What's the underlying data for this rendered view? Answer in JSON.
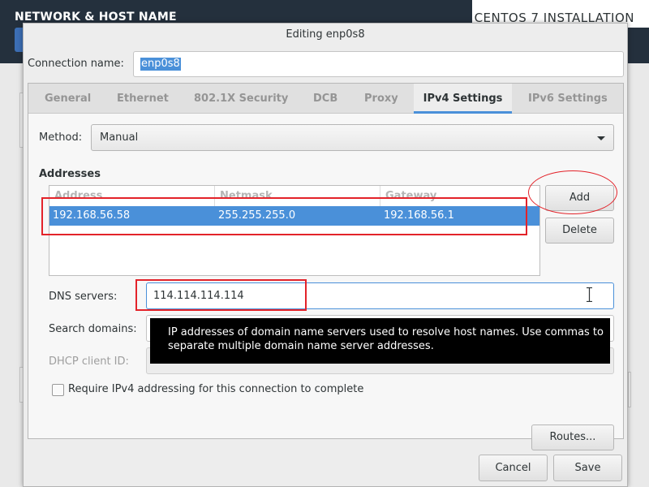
{
  "installer": {
    "title": "NETWORK & HOST NAME",
    "product": "CENTOS 7 INSTALLATION"
  },
  "dialog": {
    "title": "Editing enp0s8",
    "connection_name_label": "Connection name:",
    "connection_name_value": "enp0s8"
  },
  "tabs": [
    {
      "label": "General"
    },
    {
      "label": "Ethernet"
    },
    {
      "label": "802.1X Security"
    },
    {
      "label": "DCB"
    },
    {
      "label": "Proxy"
    },
    {
      "label": "IPv4 Settings",
      "active": true
    },
    {
      "label": "IPv6 Settings"
    }
  ],
  "ipv4": {
    "method_label": "Method:",
    "method_value": "Manual",
    "addresses_heading": "Addresses",
    "columns": [
      "Address",
      "Netmask",
      "Gateway"
    ],
    "rows": [
      {
        "address": "192.168.56.58",
        "netmask": "255.255.255.0",
        "gateway": "192.168.56.1"
      }
    ],
    "add_label": "Add",
    "delete_label": "Delete",
    "dns_label": "DNS servers:",
    "dns_value": "114.114.114.114",
    "search_label": "Search domains:",
    "dhcp_label": "DHCP client ID:",
    "tooltip": "IP addresses of domain name servers used to resolve host names. Use commas to separate multiple domain name server addresses.",
    "require_label": "Require IPv4 addressing for this connection to complete",
    "require_checked": false,
    "routes_label": "Routes..."
  },
  "footer": {
    "cancel_label": "Cancel",
    "save_label": "Save"
  },
  "colors": {
    "selection": "#4a90d9",
    "annotation": "#e3232a",
    "header": "#24303d"
  }
}
